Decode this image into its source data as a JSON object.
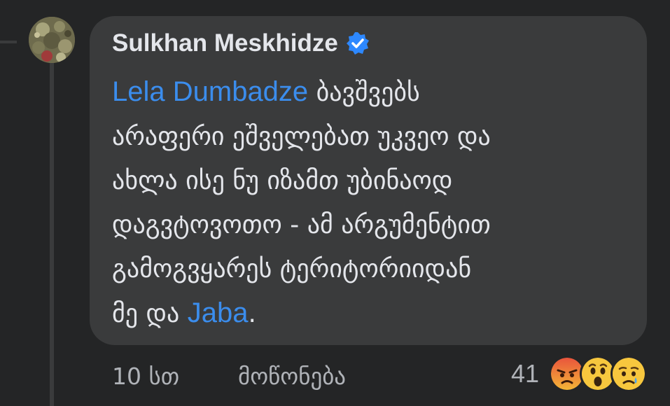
{
  "comment": {
    "author": "Sulkhan Meskhidze",
    "verified": true,
    "lines": [
      {
        "mention": "Lela Dumbadze",
        "text": " ბავშვებს"
      },
      {
        "text": "არაფერი ეშველებათ უკვეო და"
      },
      {
        "text": "ახლა ისე ნუ იზამთ უბინაოდ"
      },
      {
        "text": "დაგვტოვოთო - ამ არგუმენტით"
      },
      {
        "text": "გამოგვყარეს ტერიტორიიდან"
      },
      {
        "prefix": "მე და ",
        "mention": "Jaba",
        "suffix": "."
      }
    ]
  },
  "footer": {
    "time": "10 სთ",
    "like_label": "მოწონება",
    "reaction_count": "41",
    "reactions": [
      "angry-icon",
      "wow-icon",
      "sad-icon"
    ]
  },
  "colors": {
    "background": "#242526",
    "bubble": "#3a3b3c",
    "mention": "#3b8ded",
    "verified": "#2d88ff"
  }
}
